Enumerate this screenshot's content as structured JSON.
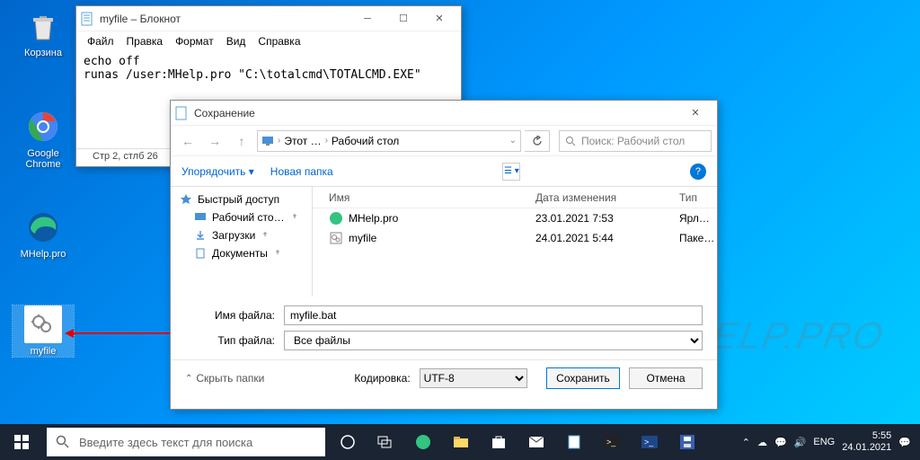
{
  "desktop": {
    "icons": [
      {
        "label": "Корзина"
      },
      {
        "label": "Google Chrome"
      },
      {
        "label": "MHelp.pro"
      },
      {
        "label": "myfile"
      }
    ]
  },
  "notepad": {
    "title": "myfile – Блокнот",
    "menu": {
      "file": "Файл",
      "edit": "Правка",
      "format": "Формат",
      "view": "Вид",
      "help": "Справка"
    },
    "content": "echo off\nrunas /user:MHelp.pro \"C:\\totalcmd\\TOTALCMD.EXE\"",
    "status": "Стр 2, стлб 26"
  },
  "savedlg": {
    "title": "Сохранение",
    "breadcrumb": {
      "root": "Этот …",
      "folder": "Рабочий стол"
    },
    "search_placeholder": "Поиск: Рабочий стол",
    "toolbar": {
      "organize": "Упорядочить",
      "newfolder": "Новая папка"
    },
    "sidebar": {
      "quick": "Быстрый доступ",
      "desktop": "Рабочий сто…",
      "downloads": "Загрузки",
      "documents": "Документы"
    },
    "columns": {
      "name": "Имя",
      "date": "Дата изменения",
      "type": "Тип"
    },
    "files": [
      {
        "name": "MHelp.pro",
        "date": "23.01.2021 7:53",
        "type": "Ярл…"
      },
      {
        "name": "myfile",
        "date": "24.01.2021 5:44",
        "type": "Паке…"
      }
    ],
    "labels": {
      "filename": "Имя файла:",
      "filetype": "Тип файла:",
      "encoding": "Кодировка:"
    },
    "values": {
      "filename": "myfile.bat",
      "filetype": "Все файлы",
      "encoding": "UTF-8"
    },
    "hide_folders": "Скрыть папки",
    "buttons": {
      "save": "Сохранить",
      "cancel": "Отмена"
    }
  },
  "taskbar": {
    "search_placeholder": "Введите здесь текст для поиска",
    "lang": "ENG",
    "time": "5:55",
    "date": "24.01.2021"
  },
  "watermark": "MHELP.PRO"
}
